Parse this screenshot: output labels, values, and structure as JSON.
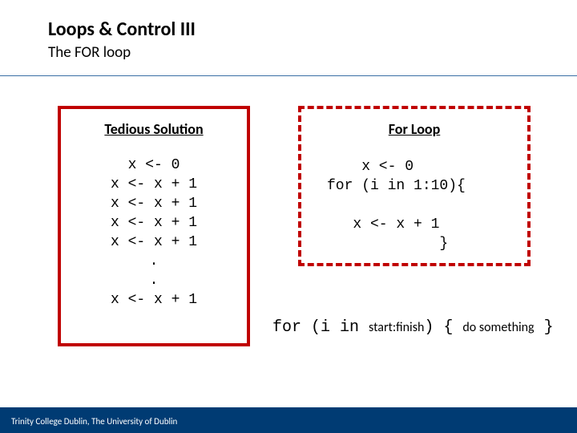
{
  "title": "Loops & Control III",
  "subtitle": "The FOR loop",
  "left": {
    "heading": "Tedious Solution",
    "code": "x <- 0\nx <- x + 1\nx <- x + 1\nx <- x + 1\nx <- x + 1\n.\n.\nx <- x + 1"
  },
  "right": {
    "heading": "For Loop",
    "code": "    x <- 0\nfor (i in 1:10){\n\n   x <- x + 1\n             }"
  },
  "syntax": {
    "prefix": "for (i in ",
    "mid": "start:finish",
    "paren": ") { ",
    "body": "do something",
    "close": " }"
  },
  "footer": "Trinity College Dublin, The University of Dublin"
}
